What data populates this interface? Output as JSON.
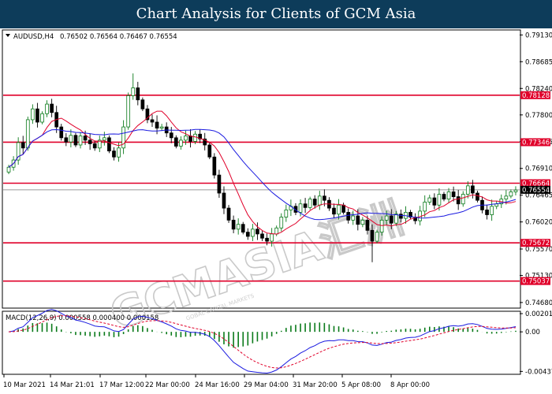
{
  "banner": {
    "title": "Chart Analysis for Clients of GCM Asia"
  },
  "header": {
    "symbol": "AUDUSD,H4",
    "ohlc": "0.76502 0.76564 0.76467 0.76554"
  },
  "watermark": {
    "text": "GCMASIA汇洲",
    "subtext": "GOBAL CAPITAL MARKETS"
  },
  "chart_data": [
    {
      "type": "line",
      "title": "",
      "ylim": [
        0.746,
        0.792
      ],
      "y_ticks": [
        "0.79130",
        "0.78685",
        "0.78240",
        "0.77800",
        "0.77355",
        "0.76910",
        "0.76465",
        "0.76020",
        "0.75570",
        "0.75130",
        "0.74680"
      ],
      "x_ticks": [
        "10 Mar 2021",
        "14 Mar 21:01",
        "17 Mar 12:00",
        "22 Mar 00:00",
        "24 Mar 16:00",
        "29 Mar 04:00",
        "31 Mar 20:00",
        "5 Apr 08:00",
        "8 Apr 00:00"
      ],
      "levels": [
        {
          "label": "0.78128",
          "value": 0.78128,
          "color": "#e0002a"
        },
        {
          "label": "0.77346",
          "value": 0.77346,
          "color": "#e0002a"
        },
        {
          "label": "0.76664",
          "value": 0.76664,
          "color": "#e0002a"
        },
        {
          "label": "0.75672",
          "value": 0.75672,
          "color": "#e0002a"
        },
        {
          "label": "0.75037",
          "value": 0.75037,
          "color": "#e0002a"
        }
      ],
      "current_price": {
        "label": "0.76554",
        "value": 0.76554
      },
      "series": [
        {
          "kind": "candles",
          "close": [
            0.7693,
            0.7705,
            0.7734,
            0.7725,
            0.7772,
            0.779,
            0.7768,
            0.7782,
            0.7798,
            0.7784,
            0.776,
            0.7742,
            0.7735,
            0.7746,
            0.773,
            0.7745,
            0.7738,
            0.7732,
            0.7725,
            0.7738,
            0.7742,
            0.772,
            0.771,
            0.7725,
            0.776,
            0.7812,
            0.7825,
            0.7805,
            0.779,
            0.7772,
            0.7768,
            0.7758,
            0.776,
            0.775,
            0.7742,
            0.7728,
            0.7738,
            0.7745,
            0.7736,
            0.7748,
            0.774,
            0.773,
            0.771,
            0.768,
            0.765,
            0.7625,
            0.7605,
            0.759,
            0.7598,
            0.7585,
            0.7578,
            0.759,
            0.7582,
            0.7575,
            0.757,
            0.7582,
            0.7592,
            0.761,
            0.7622,
            0.7628,
            0.7618,
            0.7632,
            0.7626,
            0.764,
            0.763,
            0.7645,
            0.7638,
            0.7625,
            0.7615,
            0.763,
            0.7618,
            0.7605,
            0.7612,
            0.7598,
            0.7605,
            0.7588,
            0.757,
            0.7585,
            0.7605,
            0.7612,
            0.76,
            0.7615,
            0.7608,
            0.7618,
            0.761,
            0.7604,
            0.762,
            0.7635,
            0.7642,
            0.763,
            0.7648,
            0.764,
            0.7652,
            0.7644,
            0.7632,
            0.7648,
            0.7662,
            0.765,
            0.7638,
            0.7622,
            0.7614,
            0.7628,
            0.7632,
            0.764,
            0.7645,
            0.7652,
            0.7655
          ],
          "color_up": "#0a7a1a",
          "color_down": "#000000"
        },
        {
          "name": "",
          "values_ref": "ma_fast",
          "color": "#e0002a"
        },
        {
          "name": "",
          "values_ref": "ma_slow",
          "color": "#1a1ae0"
        }
      ]
    },
    {
      "type": "bar",
      "title": "MACD(12,26,9) 0.000558 0.000400 0.000158",
      "ylim": [
        -0.0046,
        0.0021
      ],
      "y_ticks": [
        "0.002014",
        "0.00",
        "-0.00437"
      ],
      "series_colors": {
        "histogram": "#0a7a1a",
        "macd": "#1a1ae0",
        "signal": "#e0002a"
      }
    }
  ]
}
